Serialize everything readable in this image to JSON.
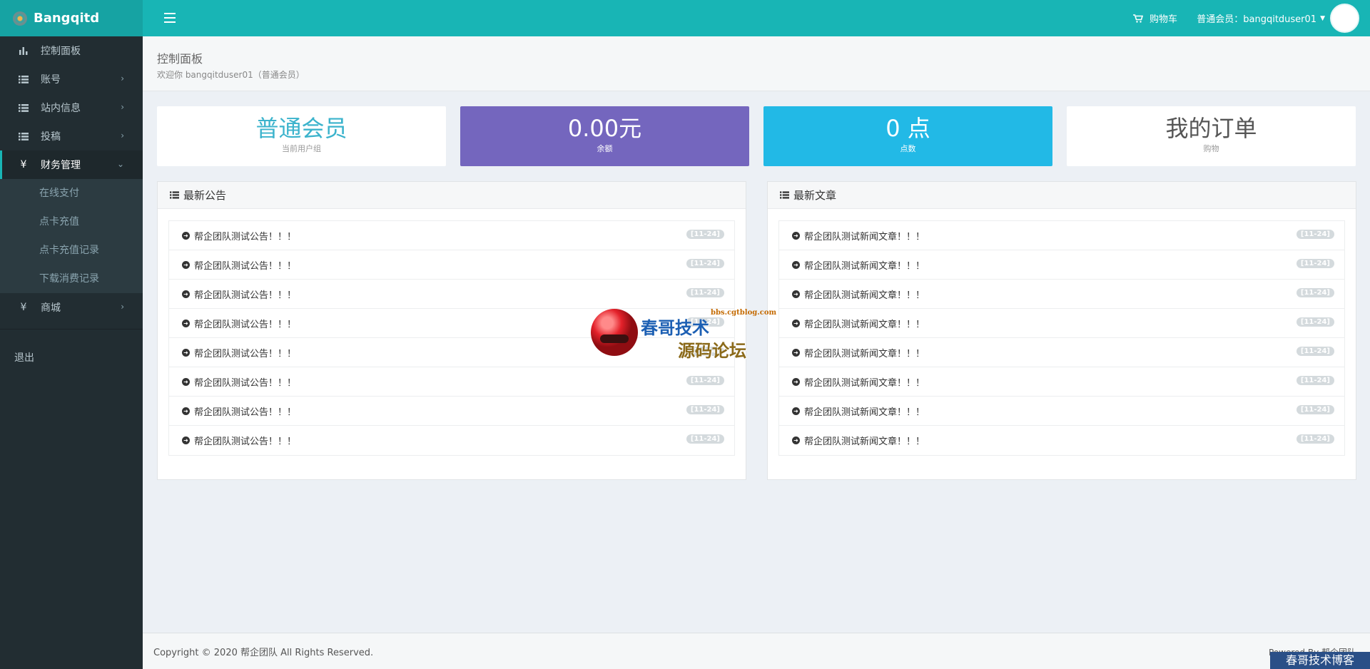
{
  "app": {
    "brand": "Bangqitd"
  },
  "header": {
    "cart_label": "购物车",
    "user_label": "普通会员：bangqitduser01"
  },
  "sidebar": {
    "items": [
      {
        "label": "控制面板",
        "icon": "bar-chart-icon"
      },
      {
        "label": "账号",
        "icon": "list-icon"
      },
      {
        "label": "站内信息",
        "icon": "list-icon"
      },
      {
        "label": "投稿",
        "icon": "list-icon"
      },
      {
        "label": "财务管理",
        "icon": "yen-icon",
        "expanded": true
      },
      {
        "label": "商城",
        "icon": "yen-icon"
      }
    ],
    "finance_submenu": [
      "在线支付",
      "点卡充值",
      "点卡充值记录",
      "下载消费记录"
    ],
    "logout": "退出"
  },
  "page": {
    "title": "控制面板",
    "subtitle": "欢迎你 bangqitduser01（普通会员）"
  },
  "stats": [
    {
      "value": "普通会员",
      "label": "当前用户组"
    },
    {
      "value": "0.00元",
      "label": "余额"
    },
    {
      "value": "0 点",
      "label": "点数"
    },
    {
      "value": "我的订单",
      "label": "购物"
    }
  ],
  "announcements": {
    "title": "最新公告",
    "items": [
      {
        "text": "帮企团队测试公告！！！",
        "date": "[11-24]"
      },
      {
        "text": "帮企团队测试公告！！！",
        "date": "[11-24]"
      },
      {
        "text": "帮企团队测试公告！！！",
        "date": "[11-24]"
      },
      {
        "text": "帮企团队测试公告！！！",
        "date": "[11-24]"
      },
      {
        "text": "帮企团队测试公告！！！",
        "date": "[11-24]"
      },
      {
        "text": "帮企团队测试公告！！！",
        "date": "[11-24]"
      },
      {
        "text": "帮企团队测试公告！！！",
        "date": "[11-24]"
      },
      {
        "text": "帮企团队测试公告！！！",
        "date": "[11-24]"
      }
    ]
  },
  "articles": {
    "title": "最新文章",
    "items": [
      {
        "text": "帮企团队测试新闻文章！！！",
        "date": "[11-24]"
      },
      {
        "text": "帮企团队测试新闻文章！！！",
        "date": "[11-24]"
      },
      {
        "text": "帮企团队测试新闻文章！！！",
        "date": "[11-24]"
      },
      {
        "text": "帮企团队测试新闻文章！！！",
        "date": "[11-24]"
      },
      {
        "text": "帮企团队测试新闻文章！！！",
        "date": "[11-24]"
      },
      {
        "text": "帮企团队测试新闻文章！！！",
        "date": "[11-24]"
      },
      {
        "text": "帮企团队测试新闻文章！！！",
        "date": "[11-24]"
      },
      {
        "text": "帮企团队测试新闻文章！！！",
        "date": "[11-24]"
      }
    ]
  },
  "footer": {
    "copyright": "Copyright © 2020 帮企团队 All Rights Reserved.",
    "powered": "Powered By 帮企团队"
  },
  "watermark": {
    "line1": "春哥技术",
    "url": "bbs.cgtblog.com",
    "line2": "源码论坛",
    "corner": "春哥技术博客"
  },
  "colors": {
    "topbar": "#18b5b5",
    "sidebar": "#222d32",
    "balance_tile": "#7466be",
    "points_tile": "#22b9e6"
  }
}
